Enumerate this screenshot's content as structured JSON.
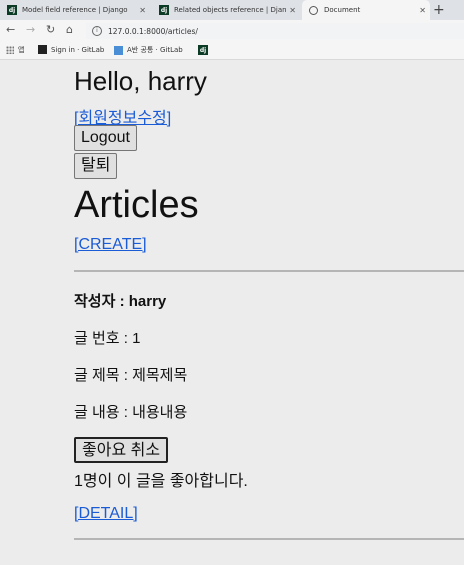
{
  "browser": {
    "tabs": [
      {
        "title": "Model field reference | Django",
        "icon": "django-icon"
      },
      {
        "title": "Related objects reference | Djan",
        "icon": "django-icon"
      },
      {
        "title": "Document",
        "icon": "globe-icon"
      }
    ],
    "url": "127.0.0.1:8000/articles/",
    "bookmarks": {
      "apps_label": "앱",
      "items": [
        {
          "label": "Sign in · GitLab"
        },
        {
          "label": "A반 공통 · GitLab"
        },
        {
          "label": ""
        }
      ]
    }
  },
  "header": {
    "greeting": "Hello, harry",
    "edit_profile_link": "[회원정보수정]",
    "logout_button": "Logout",
    "withdraw_button": "탈퇴"
  },
  "main": {
    "title": "Articles",
    "create_link": "[CREATE]",
    "articles": [
      {
        "author_line": "작성자 : harry",
        "number_line": "글 번호 : 1",
        "title_line": "글 제목 : 제목제목",
        "content_line": "글 내용 : 내용내용",
        "like_button": "좋아요 취소",
        "like_count_text": "1명이 이 글을 좋아합니다.",
        "detail_link": "[DETAIL]"
      }
    ]
  }
}
